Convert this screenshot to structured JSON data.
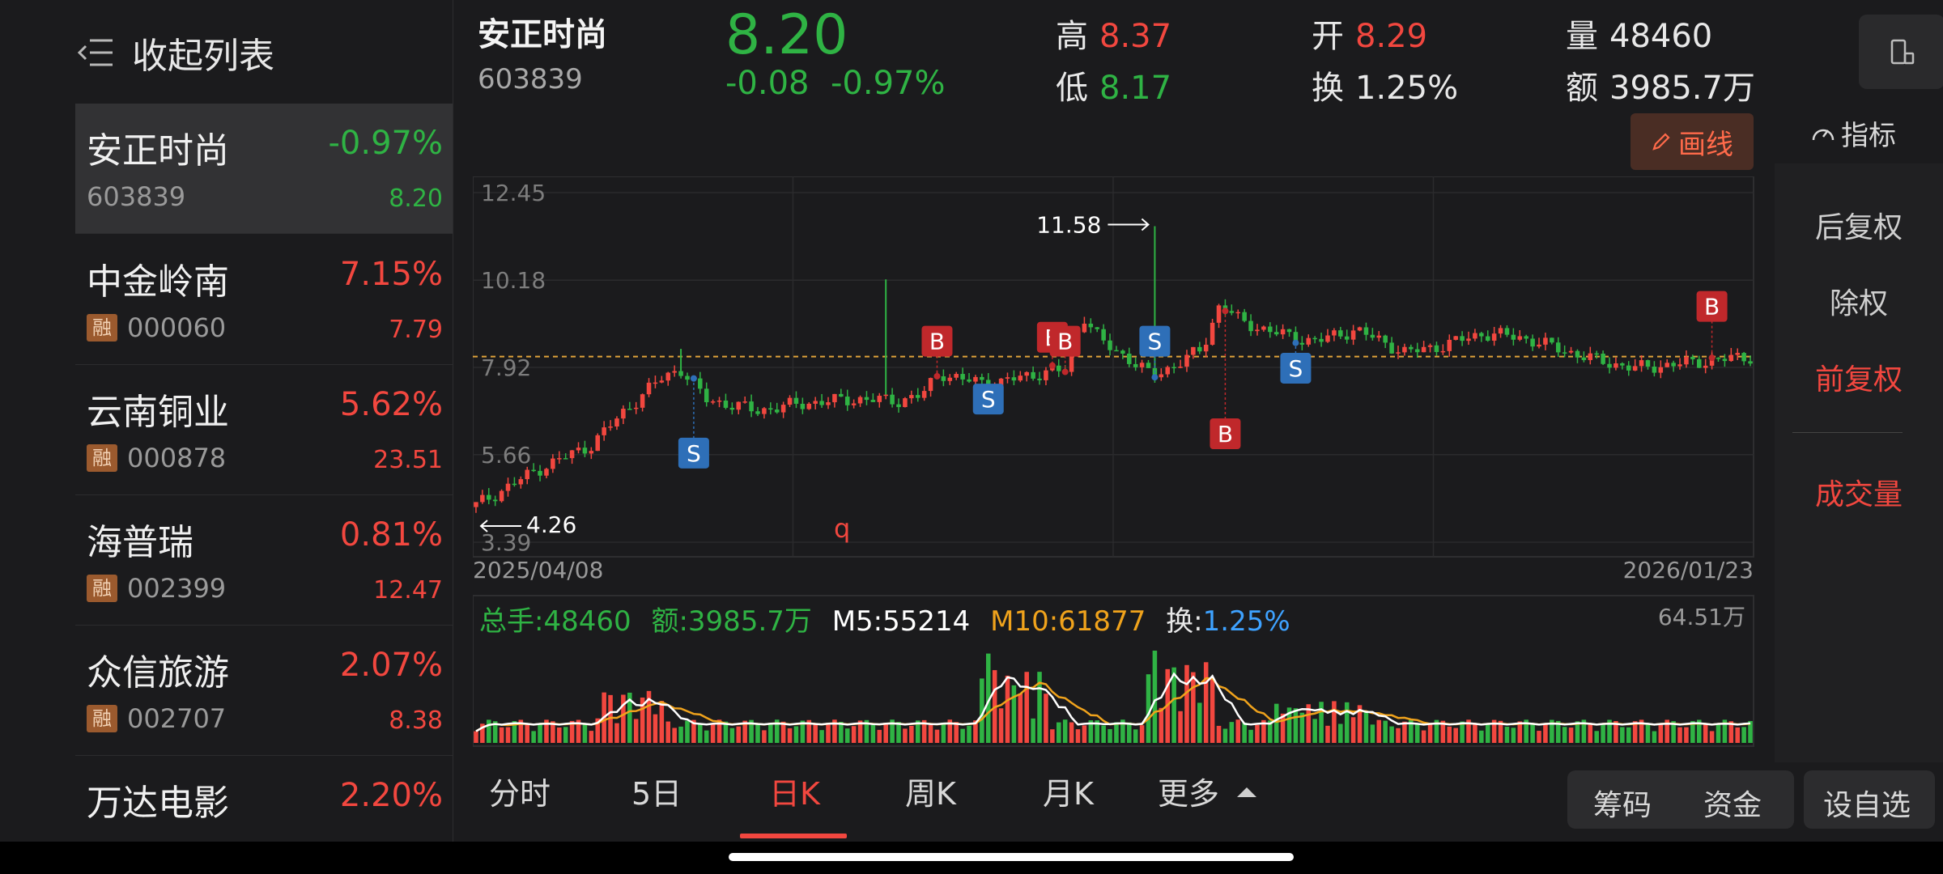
{
  "sidebar": {
    "collapse_label": "收起列表",
    "items": [
      {
        "name": "安正时尚",
        "pct": "-0.97%",
        "code": "603839",
        "price": "8.20",
        "dir": "down",
        "badge": ""
      },
      {
        "name": "中金岭南",
        "pct": "7.15%",
        "code": "000060",
        "price": "7.79",
        "dir": "up",
        "badge": "融"
      },
      {
        "name": "云南铜业",
        "pct": "5.62%",
        "code": "000878",
        "price": "23.51",
        "dir": "up",
        "badge": "融"
      },
      {
        "name": "海普瑞",
        "pct": "0.81%",
        "code": "002399",
        "price": "12.47",
        "dir": "up",
        "badge": "融"
      },
      {
        "name": "众信旅游",
        "pct": "2.07%",
        "code": "002707",
        "price": "8.38",
        "dir": "up",
        "badge": "融"
      },
      {
        "name": "万达电影",
        "pct": "2.20%",
        "code": "",
        "price": "",
        "dir": "up",
        "badge": ""
      }
    ]
  },
  "header": {
    "name": "安正时尚",
    "code": "603839",
    "price": "8.20",
    "change": "-0.08",
    "change_pct": "-0.97%",
    "high_label": "高",
    "high": "8.37",
    "low_label": "低",
    "low": "8.17",
    "open_label": "开",
    "open": "8.29",
    "turnover_label": "换",
    "turnover": "1.25%",
    "volume_label": "量",
    "volume": "48460",
    "amount_label": "额",
    "amount": "3985.7万"
  },
  "toolbar": {
    "draw_label": "画线",
    "indicator_label": "指标"
  },
  "side_options": {
    "post_adjust": "后复权",
    "ex_right": "除权",
    "pre_adjust": "前复权",
    "volume": "成交量"
  },
  "chart_data": {
    "type": "candlestick",
    "price_ticks": [
      "12.45",
      "10.18",
      "7.92",
      "5.66",
      "3.39"
    ],
    "price_range": [
      3.39,
      12.45
    ],
    "x_start_label": "2025/04/08",
    "x_end_label": "2026/01/23",
    "max_label": "11.58",
    "min_label": "4.26",
    "current_price": 8.2,
    "markers": [
      "S",
      "B",
      "S",
      "B",
      "B",
      "S",
      "B",
      "S",
      "B"
    ],
    "volume_legend": {
      "total_label": "总手:",
      "total": "48460",
      "amount_label": "额:",
      "amount": "3985.7万",
      "m5_label": "M5:",
      "m5": "55214",
      "m10_label": "M10:",
      "m10": "61877",
      "turn_label": "换:",
      "turn": "1.25%"
    },
    "volume_max_label": "64.51万",
    "colors": {
      "up": "#f2473f",
      "down": "#2fb344",
      "m5": "#ffffff",
      "m10": "#f0a31c",
      "turn": "#3ea2ff",
      "buy_marker": "#c0282b",
      "sell_marker": "#2e6fb8"
    }
  },
  "tabs": [
    {
      "label": "分时"
    },
    {
      "label": "5日"
    },
    {
      "label": "日K"
    },
    {
      "label": "周K"
    },
    {
      "label": "月K"
    },
    {
      "label": "更多"
    }
  ],
  "bottom_buttons": {
    "chips": "筹码",
    "funds": "资金",
    "add_watch": "设自选"
  },
  "icons": {
    "collapse": "collapse-list-icon",
    "mode": "landscape-toggle-icon",
    "draw": "pencil-icon",
    "indicator": "gauge-icon",
    "more": "caret-up-icon"
  }
}
